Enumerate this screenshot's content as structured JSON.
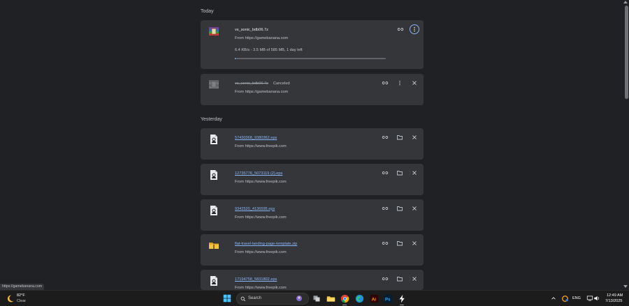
{
  "sections": {
    "today": "Today",
    "yesterday": "Yesterday"
  },
  "today_items": [
    {
      "filename": "vs_sonic_bdb06.7z",
      "source": "From https://gamebanana.com",
      "progress_text": "6.4 KB/s - 3.5 MB of 585 MB, 1 day left",
      "progress_fraction": 0.006,
      "icon": "winrar-archive-icon"
    },
    {
      "filename": "vs_sonic_bdb06.7z",
      "status": "Canceled",
      "source": "From https://gamebanana.com",
      "icon": "winrar-archive-icon"
    }
  ],
  "yesterday_items": [
    {
      "filename": "57430368_9380362.eps",
      "source": "From https://www.freepik.com",
      "icon": "document-image-icon"
    },
    {
      "filename": "12735776_5073119 (2).eps",
      "source": "From https://www.freepik.com",
      "icon": "document-image-icon"
    },
    {
      "filename": "9342520_4136595.eps",
      "source": "From https://www.freepik.com",
      "icon": "document-image-icon"
    },
    {
      "filename": "flat-travel-landing-page-template.zip",
      "source": "From https://www.freepik.com",
      "icon": "zip-folder-icon"
    },
    {
      "filename": "17194758_5831802.eps",
      "source": "From https://www.freepik.com",
      "icon": "document-image-icon"
    }
  ],
  "status_bar": {
    "url": "https://gamebanana.com"
  },
  "taskbar": {
    "weather_temp": "82°F",
    "weather_desc": "Clear",
    "search_label": "Search",
    "language": "ENG",
    "time": "12:49 AM",
    "date": "7/13/2025"
  },
  "colors": {
    "background": "#202124",
    "card": "#35363a",
    "link": "#8ab4f8",
    "progress": "#8ab4f8"
  }
}
